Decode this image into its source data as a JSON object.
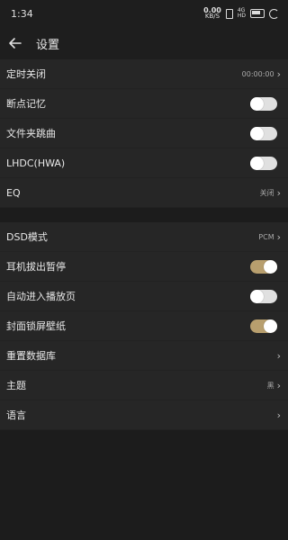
{
  "status_bar": {
    "time": "1:34",
    "speed_value": "0.00",
    "speed_unit": "KB/S",
    "net_top": "4G",
    "net_bottom": "HD"
  },
  "header": {
    "title": "设置"
  },
  "colors": {
    "accent": "#b89f6e",
    "background": "#1c1c1c",
    "row_background": "#262626"
  },
  "section1": {
    "items": [
      {
        "label": "定时关闭",
        "value": "00:00:00",
        "type": "link"
      },
      {
        "label": "断点记忆",
        "type": "toggle",
        "state": "off"
      },
      {
        "label": "文件夹跳曲",
        "type": "toggle",
        "state": "off"
      },
      {
        "label": "LHDC(HWA)",
        "type": "toggle",
        "state": "off"
      },
      {
        "label": "EQ",
        "value": "关闭",
        "type": "link"
      }
    ]
  },
  "section2": {
    "items": [
      {
        "label": "DSD模式",
        "value": "PCM",
        "type": "link"
      },
      {
        "label": "耳机拔出暂停",
        "type": "toggle",
        "state": "on"
      },
      {
        "label": "自动进入播放页",
        "type": "toggle",
        "state": "off"
      },
      {
        "label": "封面锁屏壁纸",
        "type": "toggle",
        "state": "on"
      },
      {
        "label": "重置数据库",
        "value": "",
        "type": "link"
      },
      {
        "label": "主题",
        "value": "黑",
        "type": "link"
      },
      {
        "label": "语言",
        "value": "",
        "type": "link"
      }
    ]
  },
  "icons": {
    "back": "arrow-left-icon",
    "chevron": "chevron-right-icon"
  }
}
